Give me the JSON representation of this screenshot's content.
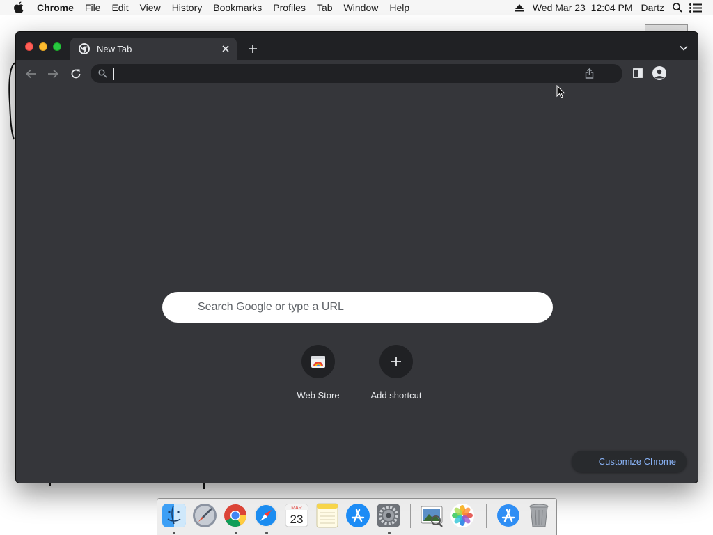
{
  "menubar": {
    "app_name": "Chrome",
    "items": [
      "File",
      "Edit",
      "View",
      "History",
      "Bookmarks",
      "Profiles",
      "Tab",
      "Window",
      "Help"
    ],
    "datetime": "Wed Mar 23  12:04 PM",
    "user": "Dartz",
    "icons": [
      "apple-icon",
      "eject-icon",
      "spotlight-icon",
      "notification-center-icon"
    ]
  },
  "browser": {
    "tab_title": "New Tab",
    "omnibox_value": "",
    "colors": {
      "frame": "#202124",
      "toolbar": "#35363a",
      "link": "#8ab4f8"
    }
  },
  "ntp": {
    "search_placeholder": "Search Google or type a URL",
    "shortcuts": [
      {
        "label": "Web Store",
        "icon": "web-store-icon"
      },
      {
        "label": "Add shortcut",
        "icon": "plus-icon"
      }
    ],
    "customize_label": "Customize Chrome"
  },
  "dock": {
    "calendar_month": "MAR",
    "calendar_day": "23",
    "apps": [
      "Finder",
      "Launchpad",
      "Google Chrome",
      "Safari",
      "Calendar",
      "Notes",
      "App Store",
      "System Preferences",
      "Preview",
      "Photos",
      "Downloads",
      "Trash"
    ],
    "running": [
      "Finder",
      "Launchpad",
      "Google Chrome",
      "Safari",
      "System Preferences"
    ]
  }
}
